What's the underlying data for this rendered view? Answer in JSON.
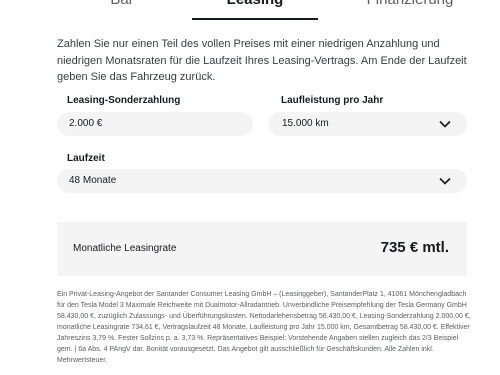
{
  "tabs": {
    "bar": "Bar",
    "leasing": "Leasing",
    "finanzierung": "Finanzierung"
  },
  "intro": "Zahlen Sie nur einen Teil des vollen Preises mit einer niedrigen Anzahlung und niedrigen Monatsraten für die Laufzeit Ihres Leasing-Vertrags. Am Ende der Laufzeit geben Sie das Fahrzeug zurück.",
  "fields": {
    "sonderzahlung_label": "Leasing-Sonderzahlung",
    "sonderzahlung_value": "2.000 €",
    "laufleistung_label": "Laufleistung pro Jahr",
    "laufleistung_value": "15.000 km",
    "laufzeit_label": "Laufzeit",
    "laufzeit_value": "48 Monate"
  },
  "summary": {
    "label": "Monatliche Leasingrate",
    "value": "735 € mtl."
  },
  "disclaimer": "Ein Privat-Leasing-Angebot der Santander Consumer Leasing GmbH – (Leasinggeber), SantanderPlatz 1, 41061 Mönchengladbach für den Tesla Model 3 Maximale Reichweite mit Dualmotor-Allradantrieb. Unverbindliche Preisempfehlung der Tesla Germany GmbH 58.430,00 €, zuzüglich Zulassungs- und Überführungskosten. Nettodarlehensbetrag 56.430,00 €, Leasing-Sonderzahlung 2.000,00 €, monatliche Leasingrate 734,61 €, Vertragslaufzeit 48 Monate, Laufleistung pro Jahr 15.000 km, Gesamtbetrag 58.430,00 €. Effektiver Jahreszins 3,79 %. Fester Sollzins p. a. 3,73 %. Repräsentatives Beispiel: Vorstehende Angaben stellen zugleich das 2/3 Beispiel gem. | 6a Abs. 4 PAngV dar. Bonität vorausgesetzt. Das Angebot gilt ausschließlich für Geschäftskunden. Alle Zahlen inkl. Mehrwertsteuer."
}
